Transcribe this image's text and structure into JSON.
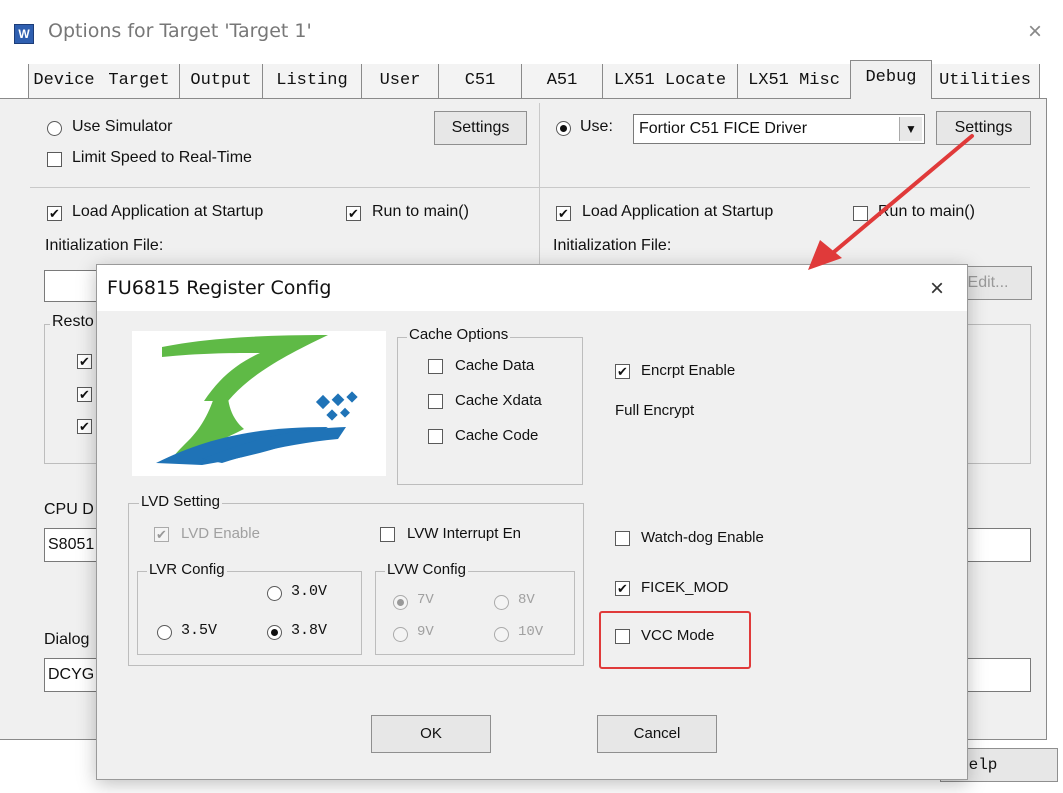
{
  "window": {
    "title": "Options for Target 'Target 1'",
    "close_glyph": "×"
  },
  "tabs": [
    "Device",
    "Target",
    "Output",
    "Listing",
    "User",
    "C51",
    "A51",
    "LX51 Locate",
    "LX51 Misc",
    "Debug",
    "Utilities"
  ],
  "active_tab": "Debug",
  "left": {
    "use_simulator": "Use Simulator",
    "limit_speed": "Limit Speed to Real-Time",
    "settings": "Settings",
    "load_app": "Load Application at Startup",
    "run_to_main": "Run to main()",
    "init_file": "Initialization File:",
    "restore_partial": "Resto",
    "cpu_partial": "CPU D",
    "cpu_value_partial": "S8051",
    "dialog_partial": "Dialog",
    "dialog_value_partial": "DCYG"
  },
  "right": {
    "use_label": "Use:",
    "driver": "Fortior C51 FICE Driver",
    "settings": "Settings",
    "load_app": "Load Application at Startup",
    "run_to_main": "Run to main()",
    "init_file": "Initialization File:",
    "edit_partial": "Edit...",
    "help_partial": "Help"
  },
  "dialog": {
    "title": "FU6815 Register Config",
    "close_glyph": "×",
    "cache_options": {
      "title": "Cache Options",
      "items": [
        "Cache Data",
        "Cache Xdata",
        "Cache Code"
      ]
    },
    "encrypt_enable": "Encrpt Enable",
    "full_encrypt": "Full Encrypt",
    "lvd": {
      "title": "LVD Setting",
      "lvd_enable": "LVD Enable",
      "lvw_interrupt": "LVW Interrupt En",
      "lvr_title": "LVR Config",
      "lvr_options": [
        "3.0V",
        "3.5V",
        "3.8V"
      ],
      "lvr_selected": "3.8V",
      "lvw_title": "LVW Config",
      "lvw_options": [
        "7V",
        "8V",
        "9V",
        "10V"
      ],
      "lvw_selected": "7V"
    },
    "watchdog": "Watch-dog Enable",
    "ficek_mod": "FICEK_MOD",
    "vcc_mode": "VCC Mode",
    "ok": "OK",
    "cancel": "Cancel"
  },
  "colors": {
    "logo_green": "#5fba46",
    "logo_blue": "#1f73b7",
    "callout_red": "#e03a3a"
  }
}
